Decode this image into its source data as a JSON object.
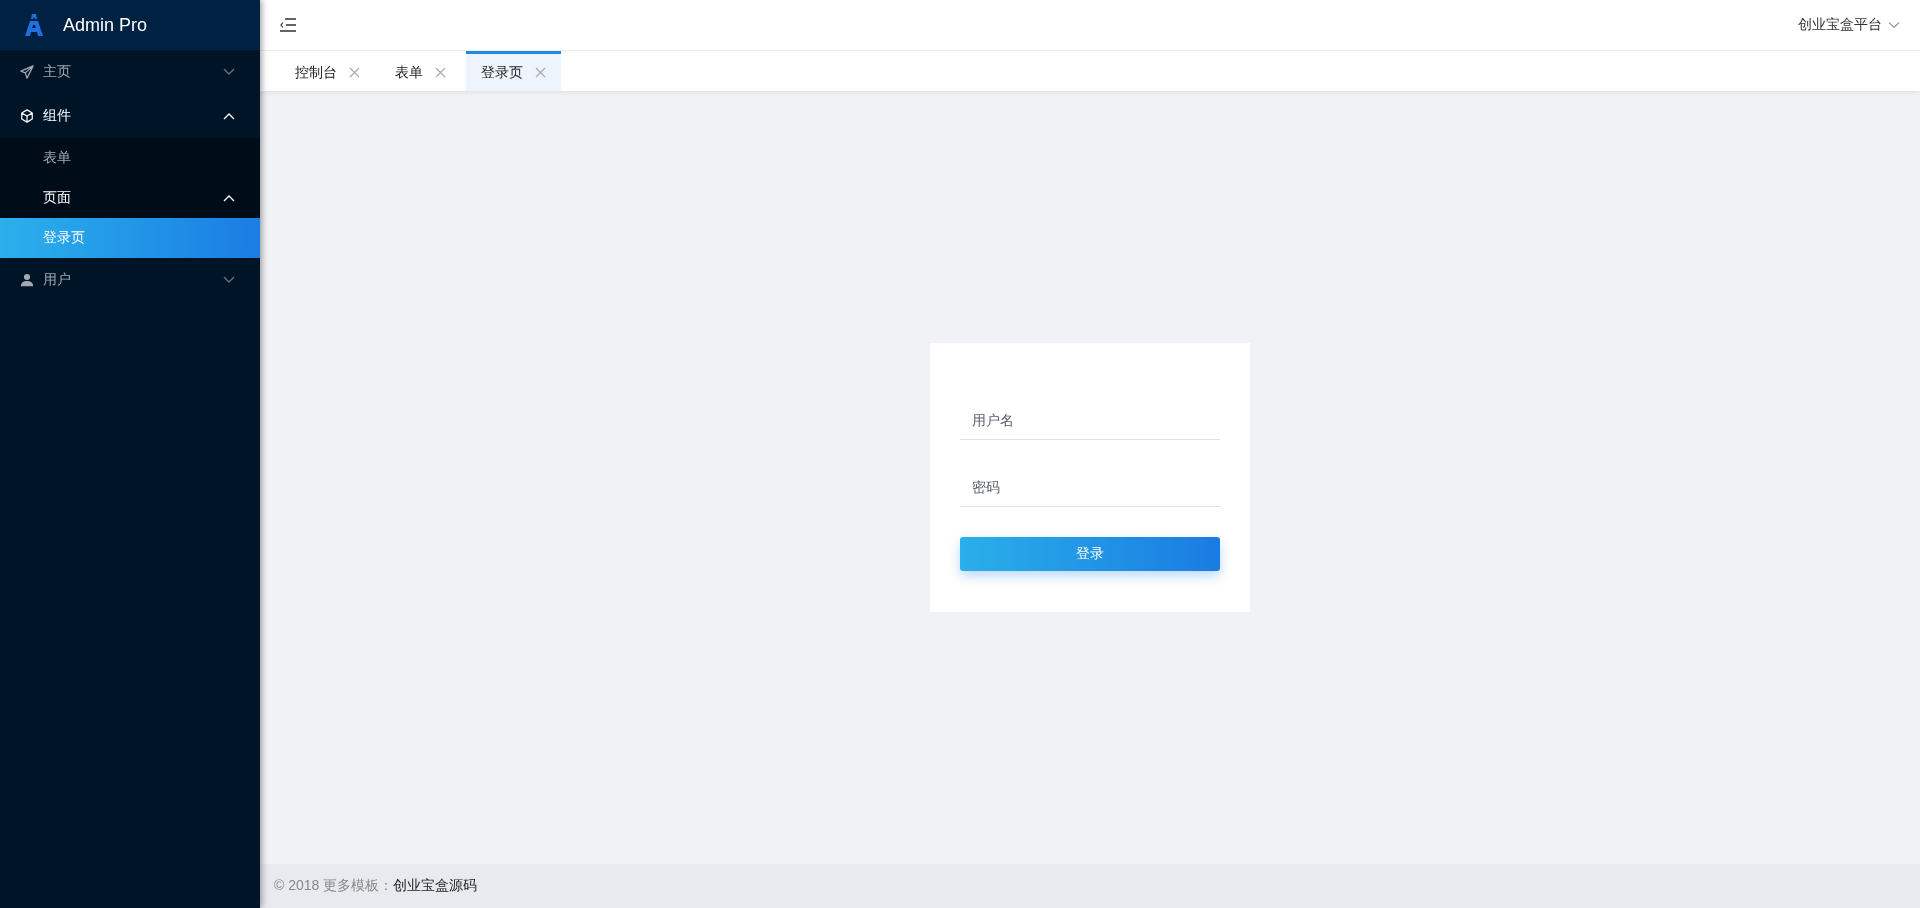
{
  "logo": {
    "title": "Admin Pro"
  },
  "sidebar": {
    "items": [
      {
        "label": "主页",
        "selected": false,
        "expanded": false
      },
      {
        "label": "组件",
        "selected": false,
        "expanded": true,
        "children": [
          {
            "label": "表单",
            "selected": false
          },
          {
            "label": "页面",
            "selected": false,
            "expanded": true,
            "children": [
              {
                "label": "登录页",
                "selected": true
              }
            ]
          }
        ]
      },
      {
        "label": "用户",
        "selected": false,
        "expanded": false
      }
    ]
  },
  "header": {
    "user_menu": "创业宝盒平台"
  },
  "tabs": [
    {
      "label": "控制台",
      "selected": false
    },
    {
      "label": "表单",
      "selected": false
    },
    {
      "label": "登录页",
      "selected": true
    }
  ],
  "login": {
    "fields": [
      {
        "placeholder": "用户名"
      },
      {
        "placeholder": "密码"
      }
    ],
    "button": "登录"
  },
  "footer": {
    "text": "© 2018 更多模板：",
    "link": "创业宝盒源码"
  }
}
